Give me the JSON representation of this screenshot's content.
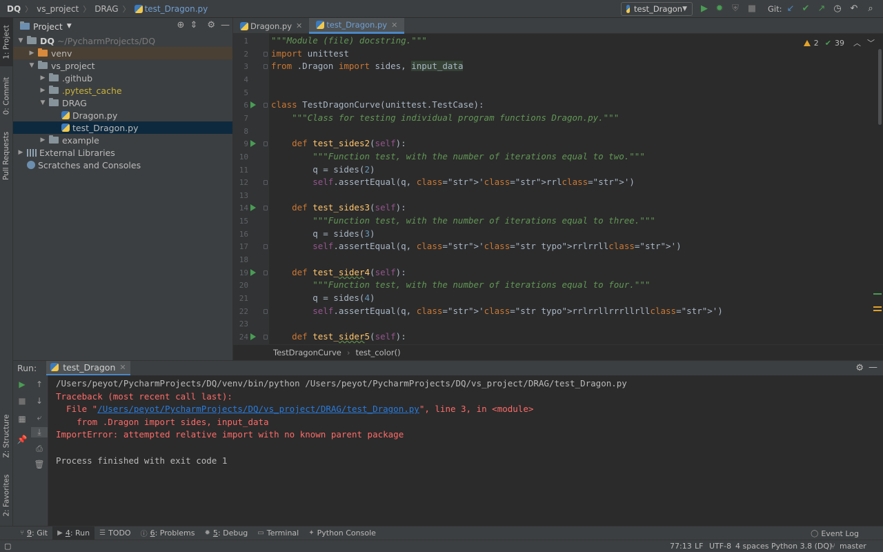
{
  "nav": {
    "breadcrumbs": [
      "DQ",
      "vs_project",
      "DRAG"
    ],
    "file": "test_Dragon.py",
    "run_config": "test_Dragon",
    "git_label": "Git:"
  },
  "left_stripe": {
    "project": "1: Project",
    "commit": "0: Commit",
    "pull_requests": "Pull Requests",
    "structure": "Z: Structure",
    "favorites": "2: Favorites"
  },
  "project_panel": {
    "title": "Project",
    "root_name": "DQ",
    "root_path": "~/PycharmProjects/DQ",
    "items": {
      "venv": "venv",
      "vs_project": "vs_project",
      "github": ".github",
      "pytest_cache": ".pytest_cache",
      "drag": "DRAG",
      "dragon_py": "Dragon.py",
      "test_dragon_py": "test_Dragon.py",
      "example": "example",
      "external_libraries": "External Libraries",
      "scratches": "Scratches and Consoles"
    }
  },
  "editor": {
    "tabs": [
      "Dragon.py",
      "test_Dragon.py"
    ],
    "inspection": {
      "warnings": "2",
      "passed": "39"
    },
    "lines": [
      "\"\"\"Module (file) docstring.\"\"\"",
      "import unittest",
      "from .Dragon import sides, input_data",
      "",
      "",
      "class TestDragonCurve(unittest.TestCase):",
      "    \"\"\"Class for testing individual program functions Dragon.py.\"\"\"",
      "",
      "    def test_sides2(self):",
      "        \"\"\"Function test, with the number of iterations equal to two.\"\"\"",
      "        q = sides(2)",
      "        self.assertEqual(q, 'rrl')",
      "",
      "    def test_sides3(self):",
      "        \"\"\"Function test, with the number of iterations equal to three.\"\"\"",
      "        q = sides(3)",
      "        self.assertEqual(q, 'rrlrrll')",
      "",
      "    def test_sider4(self):",
      "        \"\"\"Function test, with the number of iterations equal to four.\"\"\"",
      "        q = sides(4)",
      "        self.assertEqual(q, 'rrlrrllrrrllrll')",
      "",
      "    def test_sider5(self):"
    ],
    "breadcrumb": [
      "TestDragonCurve",
      "test_color()"
    ]
  },
  "run": {
    "label": "Run:",
    "tab": "test_Dragon",
    "console": [
      {
        "type": "normal",
        "text": "/Users/peyot/PycharmProjects/DQ/venv/bin/python /Users/peyot/PycharmProjects/DQ/vs_project/DRAG/test_Dragon.py"
      },
      {
        "type": "err",
        "text": "Traceback (most recent call last):"
      },
      {
        "type": "err",
        "prefix": "  File \"",
        "link": "/Users/peyot/PycharmProjects/DQ/vs_project/DRAG/test_Dragon.py",
        "suffix": "\", line 3, in <module>"
      },
      {
        "type": "err",
        "text": "    from .Dragon import sides, input_data"
      },
      {
        "type": "err",
        "text": "ImportError: attempted relative import with no known parent package"
      },
      {
        "type": "normal",
        "text": ""
      },
      {
        "type": "normal",
        "text": "Process finished with exit code 1"
      }
    ]
  },
  "toolwindows": {
    "git_num": "9",
    "git": ": Git",
    "run_num": "4",
    "run": ": Run",
    "todo": "TODO",
    "problems_num": "6",
    "problems": ": Problems",
    "debug_num": "5",
    "debug": ": Debug",
    "terminal": "Terminal",
    "python_console": "Python Console",
    "event_log": "Event Log"
  },
  "status": {
    "position": "77:13",
    "line_sep": "LF",
    "encoding": "UTF-8",
    "indent": "4 spaces",
    "interpreter": "Python 3.8 (DQ)",
    "branch": "master"
  }
}
